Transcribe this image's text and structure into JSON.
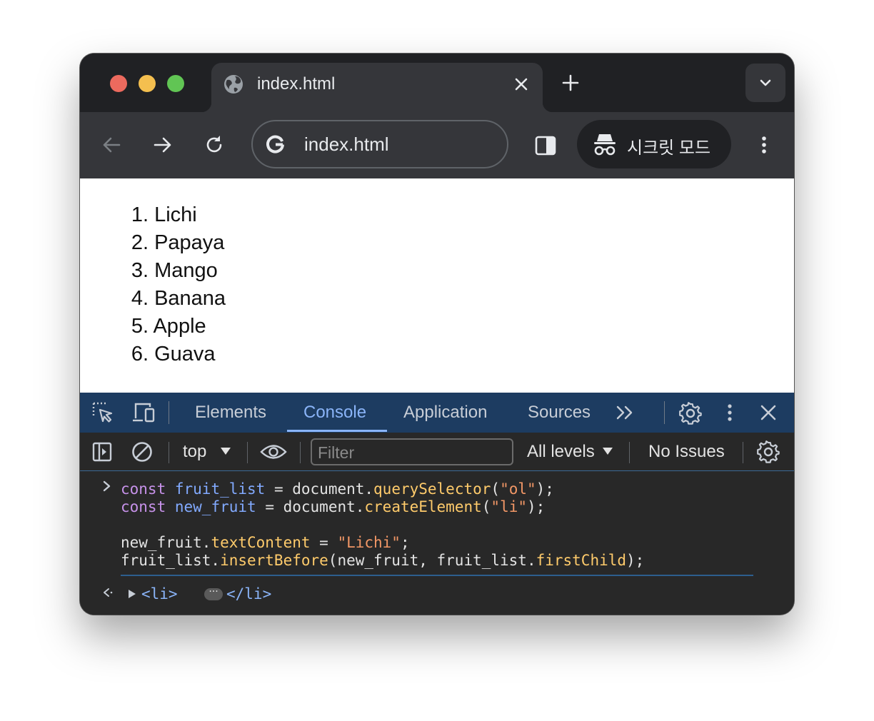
{
  "tab": {
    "title": "index.html"
  },
  "omnibox": {
    "url": "index.html"
  },
  "incognito": {
    "label": "시크릿 모드"
  },
  "page": {
    "list": [
      {
        "num": "1.",
        "text": "Lichi"
      },
      {
        "num": "2.",
        "text": "Papaya"
      },
      {
        "num": "3.",
        "text": "Mango"
      },
      {
        "num": "4.",
        "text": "Banana"
      },
      {
        "num": "5.",
        "text": "Apple"
      },
      {
        "num": "6.",
        "text": "Guava"
      }
    ]
  },
  "devtools": {
    "tabs": [
      {
        "label": "Elements",
        "active": false
      },
      {
        "label": "Console",
        "active": true
      },
      {
        "label": "Application",
        "active": false
      },
      {
        "label": "Sources",
        "active": false
      }
    ],
    "context": "top",
    "filter_placeholder": "Filter",
    "levels": "All levels",
    "issues": "No Issues"
  },
  "console": {
    "input": [
      [
        {
          "t": "const",
          "c": "kw"
        },
        {
          "t": " "
        },
        {
          "t": "fruit_list",
          "c": "var"
        },
        {
          "t": " = document."
        },
        {
          "t": "querySelector",
          "c": "fn"
        },
        {
          "t": "("
        },
        {
          "t": "\"ol\"",
          "c": "str"
        },
        {
          "t": ");"
        }
      ],
      [
        {
          "t": "const",
          "c": "kw"
        },
        {
          "t": " "
        },
        {
          "t": "new_fruit",
          "c": "var"
        },
        {
          "t": " = document."
        },
        {
          "t": "createElement",
          "c": "fn"
        },
        {
          "t": "("
        },
        {
          "t": "\"li\"",
          "c": "str"
        },
        {
          "t": ");"
        }
      ],
      [],
      [
        {
          "t": "new_fruit."
        },
        {
          "t": "textContent",
          "c": "fn"
        },
        {
          "t": " = "
        },
        {
          "t": "\"Lichi\"",
          "c": "str"
        },
        {
          "t": ";"
        }
      ],
      [
        {
          "t": "fruit_list."
        },
        {
          "t": "insertBefore",
          "c": "fn"
        },
        {
          "t": "(new_fruit, fruit_list."
        },
        {
          "t": "firstChild",
          "c": "fn"
        },
        {
          "t": ");"
        }
      ]
    ],
    "result": {
      "open": "<li>",
      "ellipsis": "···",
      "close": "</li>"
    }
  },
  "colors": {
    "devtools_tabbar": "#1d3c61",
    "accent": "#8ab4f8",
    "chrome_dark": "#202124",
    "toolbar": "#35363a"
  }
}
